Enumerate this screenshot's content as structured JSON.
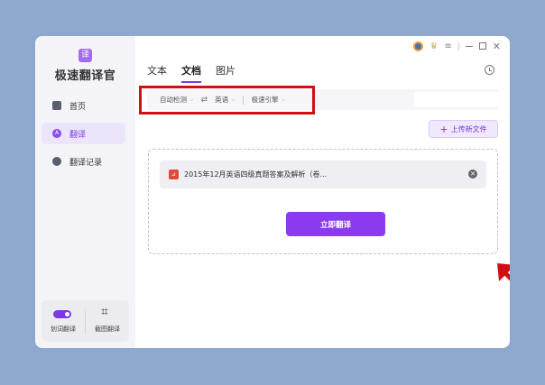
{
  "app": {
    "logo_char": "译",
    "title": "极速翻译官"
  },
  "sidebar": {
    "items": [
      {
        "label": "首页",
        "icon": "home-icon"
      },
      {
        "label": "翻译",
        "icon": "translate-icon",
        "active": true
      },
      {
        "label": "翻译记录",
        "icon": "history-icon"
      }
    ],
    "tools": [
      {
        "label": "划词翻译",
        "icon": "toggle-switch"
      },
      {
        "label": "截图翻译",
        "icon": "crop-icon"
      }
    ]
  },
  "tabs": [
    {
      "label": "文本"
    },
    {
      "label": "文档",
      "active": true
    },
    {
      "label": "图片"
    }
  ],
  "lang_bar": {
    "source": "自动检测",
    "target": "英语",
    "engine": "极速引擎"
  },
  "upload_button": "上传新文件",
  "file": {
    "name": "2015年12月英语四级真题答案及解析（卷..."
  },
  "translate_button": "立即翻译",
  "colors": {
    "accent": "#8b3af0",
    "highlight": "#d10f14",
    "background": "#8fa8cf"
  }
}
